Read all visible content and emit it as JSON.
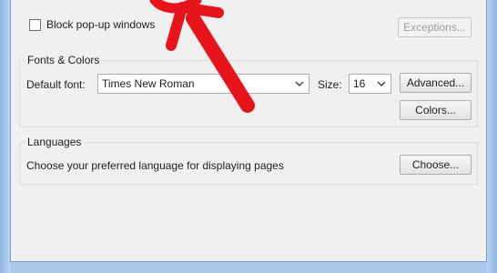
{
  "popups": {
    "block_label": "Block pop-up windows",
    "exceptions_label": "Exceptions..."
  },
  "fonts_colors": {
    "group_title": "Fonts & Colors",
    "default_font_label": "Default font:",
    "default_font_value": "Times New Roman",
    "size_label": "Size:",
    "size_value": "16",
    "advanced_label": "Advanced...",
    "colors_label": "Colors..."
  },
  "languages": {
    "group_title": "Languages",
    "description": "Choose your preferred language for displaying pages",
    "choose_label": "Choose..."
  },
  "annotation": {
    "color": "#e8141b"
  }
}
